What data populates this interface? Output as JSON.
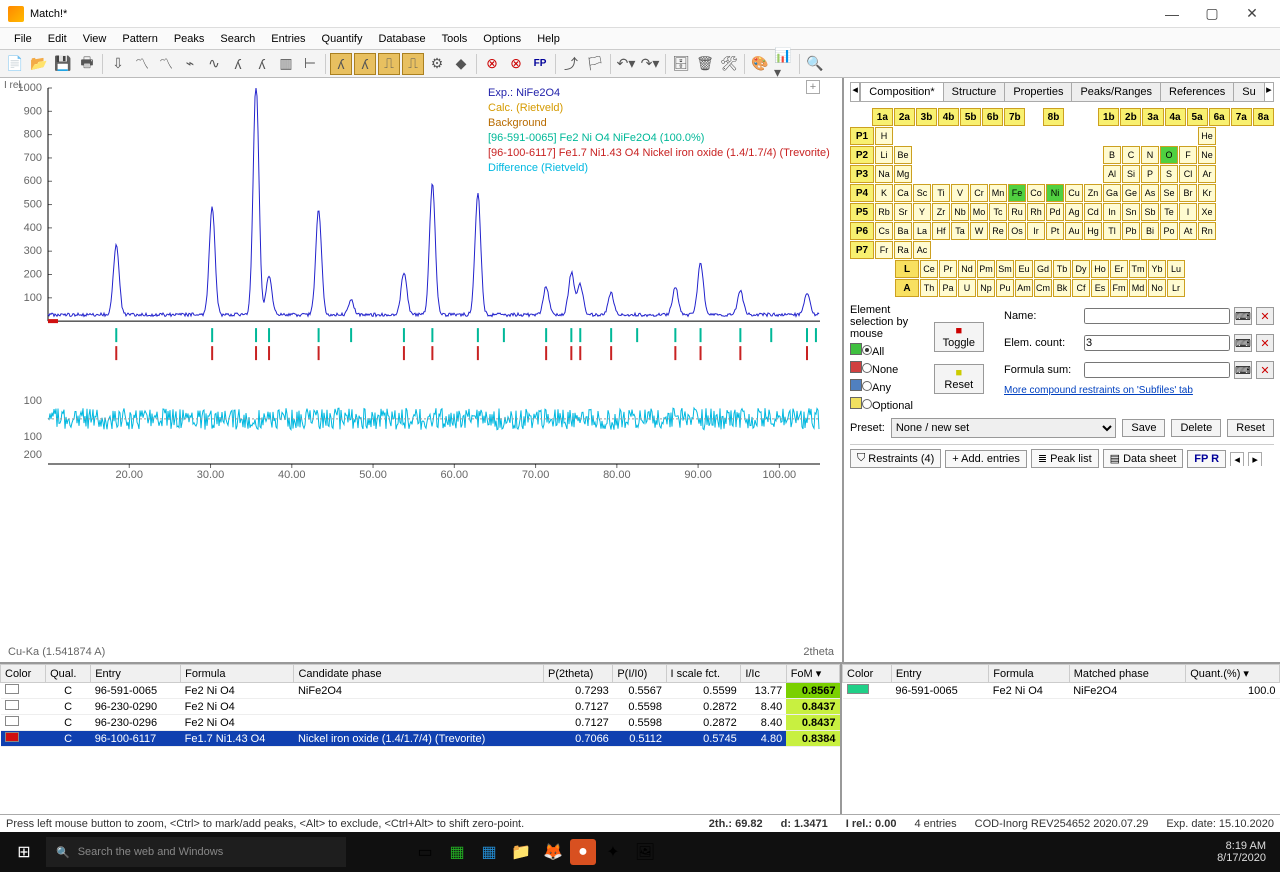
{
  "title": "Match!*",
  "menu": [
    "File",
    "Edit",
    "View",
    "Pattern",
    "Peaks",
    "Search",
    "Entries",
    "Quantify",
    "Database",
    "Tools",
    "Options",
    "Help"
  ],
  "axis_y_label": "I rel.",
  "axis_x_label": "2theta",
  "radiation": "Cu-Ka (1.541874 A)",
  "legend": {
    "exp": "Exp.: NiFe2O4",
    "calc": "Calc. (Rietveld)",
    "bg": "Background",
    "p1": "[96-591-0065] Fe2 Ni O4 NiFe2O4 (100.0%)",
    "p2": "[96-100-6117] Fe1.7 Ni1.43 O4 Nickel iron oxide (1.4/1.7/4) (Trevorite)",
    "diff": "Difference (Rietveld)"
  },
  "yticks": [
    "1000",
    "900",
    "800",
    "700",
    "600",
    "500",
    "400",
    "300",
    "200",
    "100",
    "",
    "100",
    "200"
  ],
  "xticks": [
    "20.00",
    "30.00",
    "40.00",
    "50.00",
    "60.00",
    "70.00",
    "80.00",
    "90.00",
    "100.00"
  ],
  "cand_hdr": [
    "Color",
    "Qual.",
    "Entry",
    "Formula",
    "Candidate phase",
    "P(2theta)",
    "P(I/I0)",
    "I scale fct.",
    "I/Ic",
    "FoM"
  ],
  "candidates": [
    {
      "color": "#ffffff",
      "qual": "C",
      "entry": "96-591-0065",
      "formula": "Fe2 Ni O4",
      "phase": "NiFe2O4",
      "p2t": "0.7293",
      "pii": "0.5567",
      "isf": "0.5599",
      "iic": "13.77",
      "fom": "0.8567",
      "best": true
    },
    {
      "color": "#ffffff",
      "qual": "C",
      "entry": "96-230-0290",
      "formula": "Fe2 Ni O4",
      "phase": "",
      "p2t": "0.7127",
      "pii": "0.5598",
      "isf": "0.2872",
      "iic": "8.40",
      "fom": "0.8437"
    },
    {
      "color": "#ffffff",
      "qual": "C",
      "entry": "96-230-0296",
      "formula": "Fe2 Ni O4",
      "phase": "",
      "p2t": "0.7127",
      "pii": "0.5598",
      "isf": "0.2872",
      "iic": "8.40",
      "fom": "0.8437"
    },
    {
      "color": "#d01010",
      "qual": "C",
      "entry": "96-100-6117",
      "formula": "Fe1.7 Ni1.43 O4",
      "phase": "Nickel iron oxide (1.4/1.7/4) (Trevorite)",
      "p2t": "0.7066",
      "pii": "0.5112",
      "isf": "0.5745",
      "iic": "4.80",
      "fom": "0.8384",
      "sel": true
    }
  ],
  "match_hdr": [
    "Color",
    "Entry",
    "Formula",
    "Matched phase",
    "Quant.(%)"
  ],
  "matched": [
    {
      "color": "#20d088",
      "entry": "96-591-0065",
      "formula": "Fe2 Ni O4",
      "phase": "NiFe2O4",
      "q": "100.0"
    }
  ],
  "tabs": [
    "Composition*",
    "Structure",
    "Properties",
    "Peaks/Ranges",
    "References",
    "Su"
  ],
  "grp_row": [
    "1a",
    "2a",
    "3b",
    "4b",
    "5b",
    "6b",
    "7b",
    "8b",
    "1b",
    "2b",
    "3a",
    "4a",
    "5a",
    "6a",
    "7a",
    "8a"
  ],
  "periods": [
    [
      "H",
      "",
      "",
      "",
      "",
      "",
      "",
      "",
      "",
      "",
      "",
      "",
      "",
      "",
      "",
      "",
      "",
      "He"
    ],
    [
      "Li",
      "Be",
      "",
      "",
      "",
      "",
      "",
      "",
      "",
      "",
      "",
      "",
      "B",
      "C",
      "N",
      "O",
      "F",
      "Ne"
    ],
    [
      "Na",
      "Mg",
      "",
      "",
      "",
      "",
      "",
      "",
      "",
      "",
      "",
      "",
      "Al",
      "Si",
      "P",
      "S",
      "Cl",
      "Ar"
    ],
    [
      "K",
      "Ca",
      "Sc",
      "Ti",
      "V",
      "Cr",
      "Mn",
      "Fe",
      "Co",
      "Ni",
      "Cu",
      "Zn",
      "Ga",
      "Ge",
      "As",
      "Se",
      "Br",
      "Kr"
    ],
    [
      "Rb",
      "Sr",
      "Y",
      "Zr",
      "Nb",
      "Mo",
      "Tc",
      "Ru",
      "Rh",
      "Pd",
      "Ag",
      "Cd",
      "In",
      "Sn",
      "Sb",
      "Te",
      "I",
      "Xe"
    ],
    [
      "Cs",
      "Ba",
      "La",
      "Hf",
      "Ta",
      "W",
      "Re",
      "Os",
      "Ir",
      "Pt",
      "Au",
      "Hg",
      "Tl",
      "Pb",
      "Bi",
      "Po",
      "At",
      "Rn"
    ],
    [
      "Fr",
      "Ra",
      "Ac",
      "",
      "",
      "",
      "",
      "",
      "",
      "",
      "",
      "",
      "",
      "",
      "",
      "",
      "",
      ""
    ]
  ],
  "lanth": [
    "Ce",
    "Pr",
    "Nd",
    "Pm",
    "Sm",
    "Eu",
    "Gd",
    "Tb",
    "Dy",
    "Ho",
    "Er",
    "Tm",
    "Yb",
    "Lu"
  ],
  "act": [
    "Th",
    "Pa",
    "U",
    "Np",
    "Pu",
    "Am",
    "Cm",
    "Bk",
    "Cf",
    "Es",
    "Fm",
    "Md",
    "No",
    "Lr"
  ],
  "selectedEl": [
    "Fe",
    "Ni",
    "O"
  ],
  "selmouse": "Element selection by mouse",
  "sm": {
    "all": "All",
    "none": "None",
    "any": "Any",
    "opt": "Optional",
    "toggle": "Toggle",
    "reset": "Reset"
  },
  "filters": {
    "name_l": "Name:",
    "name_v": "",
    "cnt_l": "Elem. count:",
    "cnt_v": "3",
    "form_l": "Formula sum:",
    "form_v": ""
  },
  "more": "More compound restraints on 'Subfiles' tab",
  "preset_l": "Preset:",
  "preset_v": "None / new set",
  "pb": {
    "save": "Save",
    "del": "Delete",
    "reset": "Reset"
  },
  "bb": {
    "restr": "Restraints (4)",
    "add": "+ Add. entries",
    "peak": "Peak list",
    "data": "Data sheet",
    "fp": "FP R"
  },
  "hint": "Press left mouse button to zoom, <Ctrl> to mark/add peaks, <Alt> to exclude, <Ctrl+Alt> to shift zero-point.",
  "status": {
    "tth": "2th.: 69.82",
    "d": "d: 1.3471",
    "irel": "I rel.: 0.00",
    "ent": "4 entries",
    "db": "COD-Inorg REV254652 2020.07.29",
    "exp": "Exp. date: 15.10.2020"
  },
  "search_ph": "Search the web and Windows",
  "time": "8:19 AM",
  "date": "8/17/2020",
  "chart_data": {
    "type": "line",
    "title": "",
    "xlabel": "2theta",
    "ylabel": "I rel.",
    "xlim": [
      10,
      105
    ],
    "ylim_top": [
      0,
      1000
    ],
    "ylim_bottom": [
      -250,
      250
    ],
    "peaks_exp": [
      {
        "x": 18.4,
        "y": 300
      },
      {
        "x": 30.2,
        "y": 460
      },
      {
        "x": 35.6,
        "y": 1000
      },
      {
        "x": 37.2,
        "y": 170
      },
      {
        "x": 43.3,
        "y": 450
      },
      {
        "x": 47.3,
        "y": 60
      },
      {
        "x": 53.8,
        "y": 180
      },
      {
        "x": 57.3,
        "y": 560
      },
      {
        "x": 62.9,
        "y": 520
      },
      {
        "x": 71.3,
        "y": 120
      },
      {
        "x": 74.4,
        "y": 180
      },
      {
        "x": 75.5,
        "y": 130
      },
      {
        "x": 79.3,
        "y": 90
      },
      {
        "x": 87.2,
        "y": 120
      },
      {
        "x": 90.3,
        "y": 220
      },
      {
        "x": 95.2,
        "y": 100
      },
      {
        "x": 103.4,
        "y": 90
      }
    ],
    "ticks_phase1": [
      18.4,
      30.2,
      35.6,
      37.2,
      43.3,
      47.3,
      53.8,
      57.3,
      62.9,
      66.1,
      71.3,
      74.4,
      75.5,
      79.3,
      82.5,
      87.2,
      90.3,
      95.2,
      99.0,
      103.4,
      104.5
    ],
    "ticks_phase2": [
      18.4,
      30.2,
      35.6,
      37.2,
      43.3,
      53.8,
      57.3,
      62.9,
      71.3,
      74.4,
      75.5,
      79.3,
      87.2,
      90.3,
      95.2,
      103.4
    ]
  }
}
